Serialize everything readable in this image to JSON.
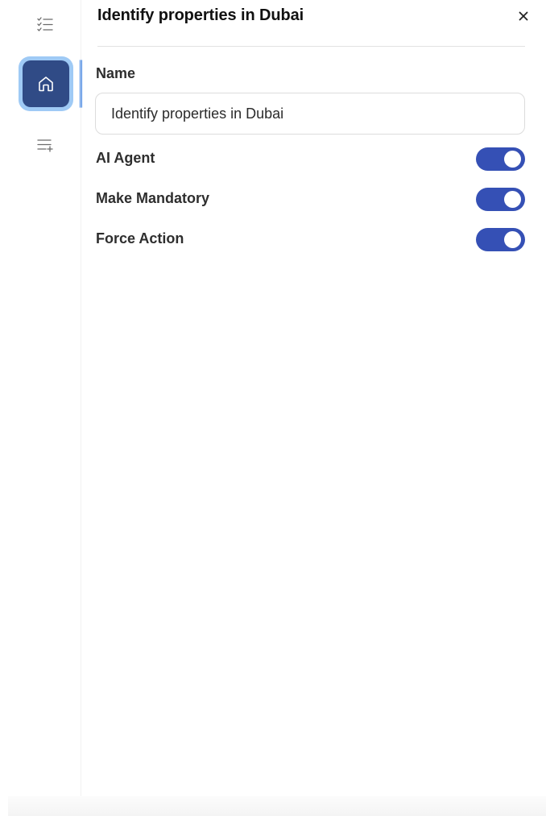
{
  "panel": {
    "title": "Identify properties in Dubai"
  },
  "rail": {
    "items": [
      {
        "name": "tasks",
        "icon": "checklist-icon",
        "active": false
      },
      {
        "name": "home",
        "icon": "home-icon",
        "active": true
      },
      {
        "name": "add-list",
        "icon": "list-add-icon",
        "active": false
      }
    ]
  },
  "close": {
    "icon": "close-icon",
    "glyph": "×"
  },
  "form": {
    "name_label": "Name",
    "name_value": "Identify properties in Dubai",
    "toggles": [
      {
        "label": "AI Agent",
        "on": true
      },
      {
        "label": "Make Mandatory",
        "on": true
      },
      {
        "label": "Force Action",
        "on": true
      }
    ]
  },
  "colors": {
    "toggle_on": "#3550b5",
    "active_nav": "#304b86",
    "active_nav_ring": "#9fcaf5",
    "active_indicator": "#2f7be5"
  }
}
